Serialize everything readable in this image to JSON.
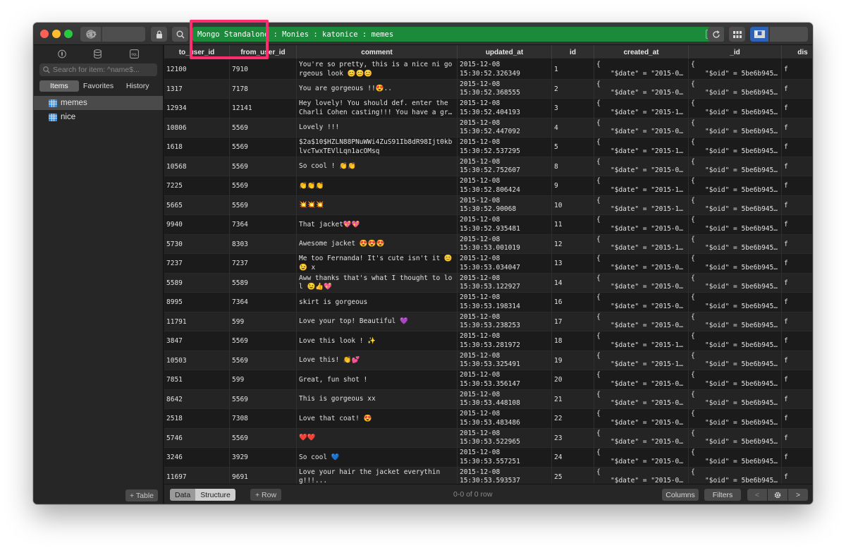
{
  "window": {
    "path": "Mongo Standalone : Monies : katonice : memes",
    "path_badge": "loc"
  },
  "sidebar": {
    "search_placeholder": "Search for item: ^name$...",
    "tabs": [
      "Items",
      "Favorites",
      "History"
    ],
    "items": [
      {
        "label": "memes"
      },
      {
        "label": "nice"
      }
    ],
    "add_table": "+ Table"
  },
  "grid": {
    "columns": [
      "to_user_id",
      "from_user_id",
      "comment",
      "updated_at",
      "id",
      "created_at",
      "_id",
      "dis"
    ],
    "rows": [
      {
        "to_user_id": "12100",
        "from_user_id": "7910",
        "comment": "You're so pretty, this is a nice ni gorgeous look 😊😊😊",
        "updated_date": "2015-12-08",
        "updated_time": "15:30:52.326349",
        "id": "1",
        "created_l1": "{",
        "created_l2": "\"$date\" = \"2015-08...",
        "oid_l1": "{",
        "oid_l2": "\"$oid\" = 5be6b9451...",
        "dis": "f"
      },
      {
        "to_user_id": "1317",
        "from_user_id": "7178",
        "comment": "You are gorgeous !!😍..",
        "updated_date": "2015-12-08",
        "updated_time": "15:30:52.368555",
        "id": "2",
        "created_l1": "{",
        "created_l2": "\"$date\" = \"2015-09...",
        "oid_l1": "{",
        "oid_l2": "\"$oid\" = 5be6b9451...",
        "dis": "f"
      },
      {
        "to_user_id": "12934",
        "from_user_id": "12141",
        "comment": "Hey lovely! You should def. enter the Charli Cohen casting!!! You have a grea...",
        "updated_date": "2015-12-08",
        "updated_time": "15:30:52.404193",
        "id": "3",
        "created_l1": "{",
        "created_l2": "\"$date\" = \"2015-12...",
        "oid_l1": "{",
        "oid_l2": "\"$oid\" = 5be6b9451...",
        "dis": "f"
      },
      {
        "to_user_id": "10806",
        "from_user_id": "5569",
        "comment": "Lovely !!!",
        "updated_date": "2015-12-08",
        "updated_time": "15:30:52.447092",
        "id": "4",
        "created_l1": "{",
        "created_l2": "\"$date\" = \"2015-08...",
        "oid_l1": "{",
        "oid_l2": "\"$oid\" = 5be6b9451...",
        "dis": "f"
      },
      {
        "to_user_id": "1618",
        "from_user_id": "5569",
        "comment": "$2a$10$HZLN88PNuWWi4ZuS91Ib8dR98Ijt0kblvcTwxTEVlLqn1acOMsq",
        "updated_date": "2015-12-08",
        "updated_time": "15:30:52.537295",
        "id": "5",
        "created_l1": "{",
        "created_l2": "\"$date\" = \"2015-10...",
        "oid_l1": "{",
        "oid_l2": "\"$oid\" = 5be6b9451...",
        "dis": "f"
      },
      {
        "to_user_id": "10568",
        "from_user_id": "5569",
        "comment": "So cool ! 👏👏",
        "updated_date": "2015-12-08",
        "updated_time": "15:30:52.752607",
        "id": "8",
        "created_l1": "{",
        "created_l2": "\"$date\" = \"2015-08...",
        "oid_l1": "{",
        "oid_l2": "\"$oid\" = 5be6b9451...",
        "dis": "f"
      },
      {
        "to_user_id": "7225",
        "from_user_id": "5569",
        "comment": "👏👏👏",
        "updated_date": "2015-12-08",
        "updated_time": "15:30:52.806424",
        "id": "9",
        "created_l1": "{",
        "created_l2": "\"$date\" = \"2015-10...",
        "oid_l1": "{",
        "oid_l2": "\"$oid\" = 5be6b9451...",
        "dis": "f"
      },
      {
        "to_user_id": "5665",
        "from_user_id": "5569",
        "comment": "💥💥💥",
        "updated_date": "2015-12-08",
        "updated_time": "15:30:52.90068",
        "id": "10",
        "created_l1": "{",
        "created_l2": "\"$date\" = \"2015-11...",
        "oid_l1": "{",
        "oid_l2": "\"$oid\" = 5be6b9451...",
        "dis": "f"
      },
      {
        "to_user_id": "9940",
        "from_user_id": "7364",
        "comment": "That jacket💖💖",
        "updated_date": "2015-12-08",
        "updated_time": "15:30:52.935481",
        "id": "11",
        "created_l1": "{",
        "created_l2": "\"$date\" = \"2015-08...",
        "oid_l1": "{",
        "oid_l2": "\"$oid\" = 5be6b9451...",
        "dis": "f"
      },
      {
        "to_user_id": "5730",
        "from_user_id": "8303",
        "comment": "Awesome jacket 😍😍😍",
        "updated_date": "2015-12-08",
        "updated_time": "15:30:53.001019",
        "id": "12",
        "created_l1": "{",
        "created_l2": "\"$date\" = \"2015-11...",
        "oid_l1": "{",
        "oid_l2": "\"$oid\" = 5be6b9451...",
        "dis": "f"
      },
      {
        "to_user_id": "7237",
        "from_user_id": "7237",
        "comment": "Me too Fernanda! It's cute isn't it 😊😉 x",
        "updated_date": "2015-12-08",
        "updated_time": "15:30:53.034047",
        "id": "13",
        "created_l1": "{",
        "created_l2": "\"$date\" = \"2015-09...",
        "oid_l1": "{",
        "oid_l2": "\"$oid\" = 5be6b9451...",
        "dis": "f"
      },
      {
        "to_user_id": "5589",
        "from_user_id": "5589",
        "comment": "Aww thanks that's what I thought to lol 😉👍💖",
        "updated_date": "2015-12-08",
        "updated_time": "15:30:53.122927",
        "id": "14",
        "created_l1": "{",
        "created_l2": "\"$date\" = \"2015-08...",
        "oid_l1": "{",
        "oid_l2": "\"$oid\" = 5be6b9451...",
        "dis": "f"
      },
      {
        "to_user_id": "8995",
        "from_user_id": "7364",
        "comment": "skirt is gorgeous",
        "updated_date": "2015-12-08",
        "updated_time": "15:30:53.198314",
        "id": "16",
        "created_l1": "{",
        "created_l2": "\"$date\" = \"2015-08...",
        "oid_l1": "{",
        "oid_l2": "\"$oid\" = 5be6b9451...",
        "dis": "f"
      },
      {
        "to_user_id": "11791",
        "from_user_id": "599",
        "comment": "Love your top! Beautiful 💜",
        "updated_date": "2015-12-08",
        "updated_time": "15:30:53.238253",
        "id": "17",
        "created_l1": "{",
        "created_l2": "\"$date\" = \"2015-08...",
        "oid_l1": "{",
        "oid_l2": "\"$oid\" = 5be6b9451...",
        "dis": "f"
      },
      {
        "to_user_id": "3847",
        "from_user_id": "5569",
        "comment": "Love this look ! ✨",
        "updated_date": "2015-12-08",
        "updated_time": "15:30:53.281972",
        "id": "18",
        "created_l1": "{",
        "created_l2": "\"$date\" = \"2015-11...",
        "oid_l1": "{",
        "oid_l2": "\"$oid\" = 5be6b9451...",
        "dis": "f"
      },
      {
        "to_user_id": "10503",
        "from_user_id": "5569",
        "comment": "Love this! 👏💕",
        "updated_date": "2015-12-08",
        "updated_time": "15:30:53.325491",
        "id": "19",
        "created_l1": "{",
        "created_l2": "\"$date\" = \"2015-11...",
        "oid_l1": "{",
        "oid_l2": "\"$oid\" = 5be6b9451...",
        "dis": "f"
      },
      {
        "to_user_id": "7851",
        "from_user_id": "599",
        "comment": "Great, fun shot !",
        "updated_date": "2015-12-08",
        "updated_time": "15:30:53.356147",
        "id": "20",
        "created_l1": "{",
        "created_l2": "\"$date\" = \"2015-08...",
        "oid_l1": "{",
        "oid_l2": "\"$oid\" = 5be6b9451...",
        "dis": "f"
      },
      {
        "to_user_id": "8642",
        "from_user_id": "5569",
        "comment": "This is gorgeous xx",
        "updated_date": "2015-12-08",
        "updated_time": "15:30:53.448108",
        "id": "21",
        "created_l1": "{",
        "created_l2": "\"$date\" = \"2015-08...",
        "oid_l1": "{",
        "oid_l2": "\"$oid\" = 5be6b9451...",
        "dis": "f"
      },
      {
        "to_user_id": "2518",
        "from_user_id": "7308",
        "comment": "Love that coat! 😍",
        "updated_date": "2015-12-08",
        "updated_time": "15:30:53.483486",
        "id": "22",
        "created_l1": "{",
        "created_l2": "\"$date\" = \"2015-08...",
        "oid_l1": "{",
        "oid_l2": "\"$oid\" = 5be6b9451...",
        "dis": "f"
      },
      {
        "to_user_id": "5746",
        "from_user_id": "5569",
        "comment": "❤️❤️",
        "updated_date": "2015-12-08",
        "updated_time": "15:30:53.522965",
        "id": "23",
        "created_l1": "{",
        "created_l2": "\"$date\" = \"2015-09...",
        "oid_l1": "{",
        "oid_l2": "\"$oid\" = 5be6b9451...",
        "dis": "f"
      },
      {
        "to_user_id": "3246",
        "from_user_id": "3929",
        "comment": "So cool 💙",
        "updated_date": "2015-12-08",
        "updated_time": "15:30:53.557251",
        "id": "24",
        "created_l1": "{",
        "created_l2": "\"$date\" = \"2015-08...",
        "oid_l1": "{",
        "oid_l2": "\"$oid\" = 5be6b9451...",
        "dis": "f"
      },
      {
        "to_user_id": "11697",
        "from_user_id": "9691",
        "comment": "Love your hair the jacket everything!!!...",
        "updated_date": "2015-12-08",
        "updated_time": "15:30:53.593537",
        "id": "25",
        "created_l1": "{",
        "created_l2": "\"$date\" = \"2015-08...",
        "oid_l1": "{",
        "oid_l2": "\"$oid\" = 5be6b9451...",
        "dis": "f"
      }
    ]
  },
  "bottombar": {
    "view_tabs": [
      "Data",
      "Structure"
    ],
    "add_row": "+ Row",
    "row_count": "0-0 of 0 row",
    "columns_button": "Columns",
    "filters_button": "Filters",
    "prev": "<",
    "next": ">"
  },
  "colors": {
    "path_bar": "#1b8a3b",
    "highlight": "#ff2d6e",
    "table_icon": "#3f8fe0"
  }
}
